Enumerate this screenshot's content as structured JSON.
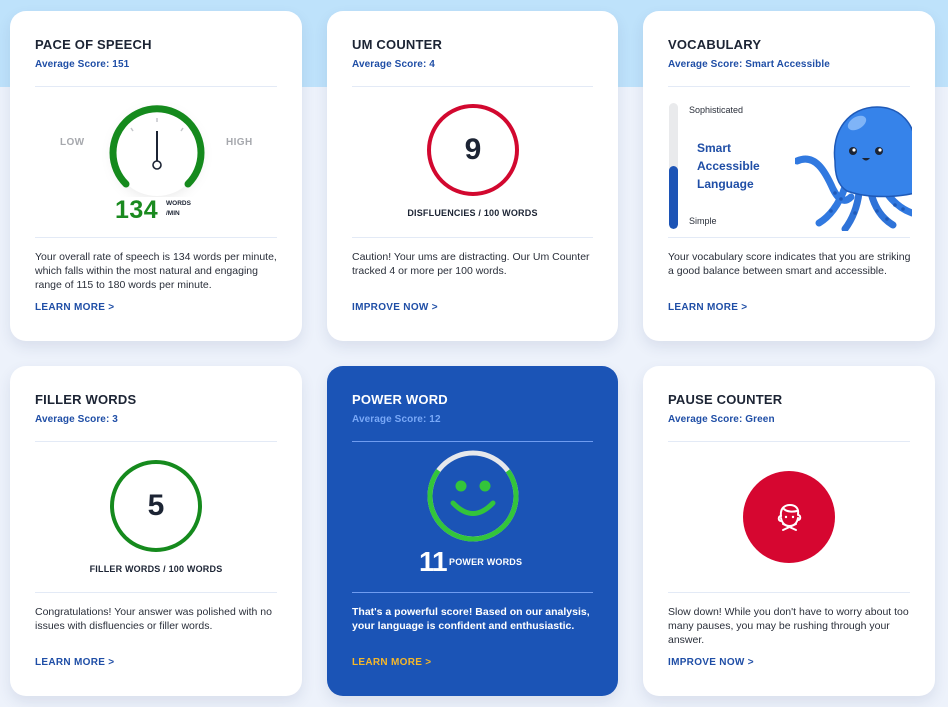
{
  "colors": {
    "accent_blue": "#1f4ea6",
    "power_card_bg": "#1b54b6",
    "green": "#158a1d",
    "red": "#d2082f",
    "link_yellow": "#f5b72a",
    "top_band": "#bee2fb",
    "page_bg": "#edf2fb"
  },
  "cards": {
    "pace": {
      "title": "PACE OF SPEECH",
      "average": "Average Score: 151",
      "low_label": "LOW",
      "high_label": "HIGH",
      "value": "134",
      "unit_line1": "WORDS",
      "unit_line2": "/MIN",
      "gauge_position": 0.5,
      "description": "Your overall rate of speech is 134 words per minute, which falls within the most natural and engaging range of 115 to 180 words per minute.",
      "link": "LEARN MORE >"
    },
    "um": {
      "title": "UM COUNTER",
      "average": "Average Score: 4",
      "value": "9",
      "caption": "DISFLUENCIES / 100 WORDS",
      "description": "Caution! Your ums are distracting. Our Um Counter tracked 4 or more per 100 words.",
      "link": "IMPROVE NOW >"
    },
    "vocabulary": {
      "title": "VOCABULARY",
      "average": "Average Score: Smart Accessible",
      "scale_top": "Sophisticated",
      "scale_bottom": "Simple",
      "level_line1": "Smart",
      "level_line2": "Accessible",
      "level_line3": "Language",
      "level_fraction": 0.5,
      "mascot": "octopus-mascot",
      "description": "Your vocabulary score indicates that you are striking a good balance between smart and accessible.",
      "link": "LEARN MORE >"
    },
    "filler": {
      "title": "FILLER WORDS",
      "average": "Average Score: 3",
      "value": "5",
      "caption": "FILLER WORDS / 100 WORDS",
      "description": "Congratulations! Your answer was polished with no issues with disfluencies or filler words.",
      "link": "LEARN MORE >"
    },
    "power": {
      "title": "POWER WORD",
      "average": "Average Score: 12",
      "value": "11",
      "label": "POWER WORDS",
      "ring_fraction": 0.7,
      "icon": "smiley-face-icon",
      "description": "That's a powerful score! Based on our analysis, your language is confident and enthusiastic.",
      "link": "LEARN MORE >"
    },
    "pause": {
      "title": "PAUSE COUNTER",
      "average": "Average Score: Green",
      "icon": "silent-face-icon",
      "description": "Slow down! While you don't have to worry about too many pauses, you may be rushing through your answer.",
      "link": "IMPROVE NOW >"
    }
  }
}
